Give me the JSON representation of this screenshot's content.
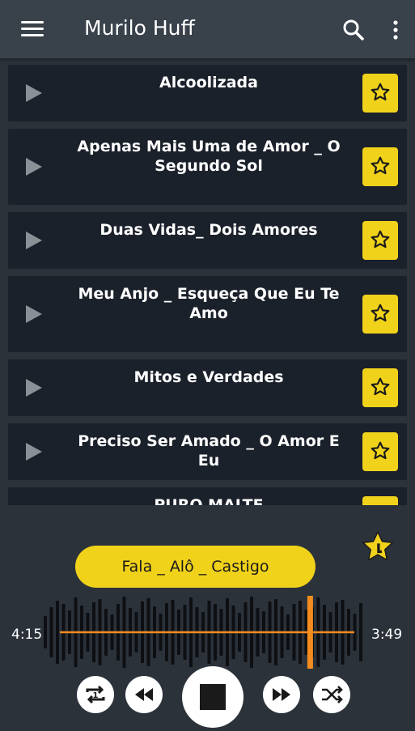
{
  "appbar": {
    "title": "Murilo Huff"
  },
  "songs": [
    {
      "title": "Alcoolizada"
    },
    {
      "title": "Apenas Mais Uma de Amor _ O Segundo Sol"
    },
    {
      "title": "Duas Vidas_ Dois Amores"
    },
    {
      "title": "Meu Anjo _ Esqueça Que Eu Te Amo"
    },
    {
      "title": "Mitos e Verdades"
    },
    {
      "title": "Preciso Ser Amado _ O Amor E Eu"
    },
    {
      "title": "PURO MALTE"
    }
  ],
  "player": {
    "now_playing": "Fala _ Alô _ Castigo",
    "elapsed": "4:15",
    "remaining": "3:49",
    "progress": 0.85
  },
  "colors": {
    "accent": "#f0d21b",
    "row_bg": "#1b212b",
    "app_bg": "#2b323a",
    "appbar_bg": "#39414b",
    "progress_line": "#f28c1e"
  },
  "icons": {
    "menu": "menu-icon",
    "search": "search-icon",
    "more": "more-vert-icon",
    "play": "play-icon",
    "favorite": "star-icon",
    "repeat": "repeat-one-icon",
    "previous": "rewind-icon",
    "stop": "stop-icon",
    "next": "fast-forward-icon",
    "shuffle": "shuffle-icon"
  }
}
